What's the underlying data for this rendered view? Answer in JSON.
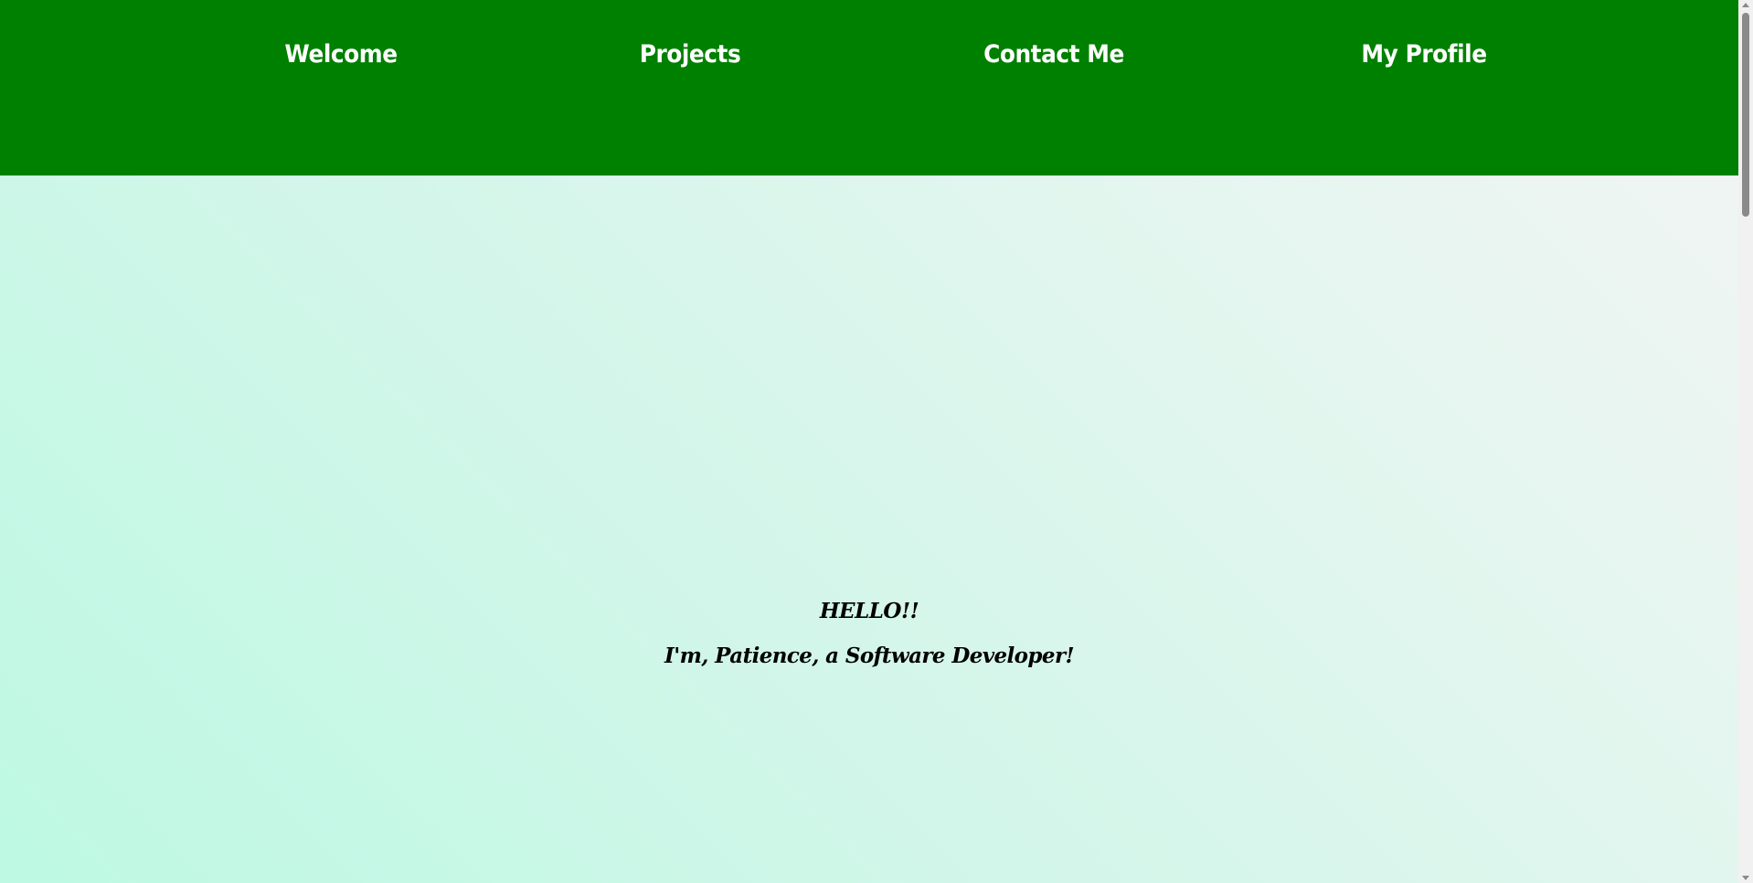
{
  "nav": {
    "items": [
      {
        "label": "Welcome"
      },
      {
        "label": "Projects"
      },
      {
        "label": "Contact Me"
      },
      {
        "label": "My Profile"
      }
    ]
  },
  "hero": {
    "greeting": "HELLO!!",
    "intro": "I'm, Patience, a Software Developer!"
  },
  "colors": {
    "nav_background": "#008000",
    "nav_text": "#ffffff",
    "hero_gradient_start": "#bdf9e3",
    "hero_gradient_end": "#f0f5f3",
    "hero_text": "#000000"
  }
}
